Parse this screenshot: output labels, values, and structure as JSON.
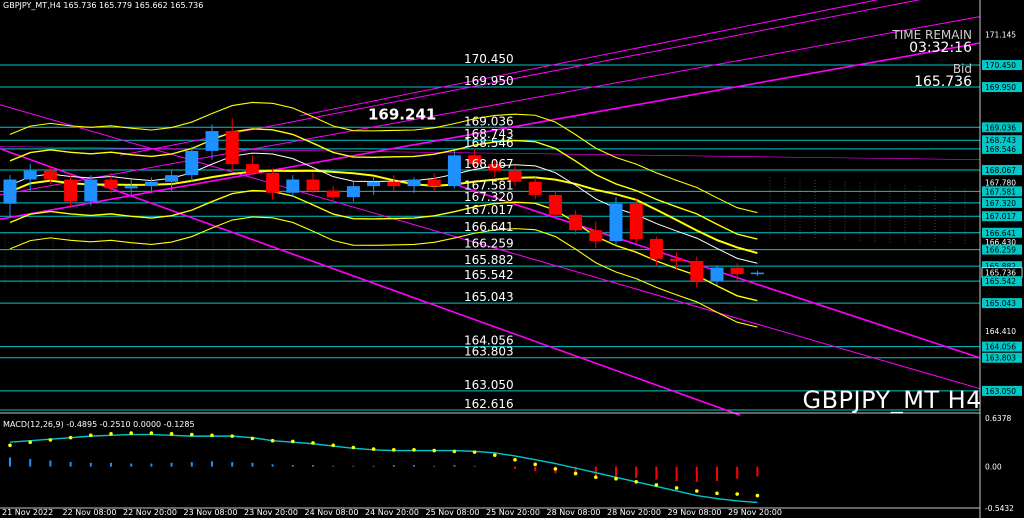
{
  "header": {
    "info": "GBPJPY_MT,H4  165.736 165.779 165.662 165.736"
  },
  "overlay": {
    "time_remain_label": "TIME REMAIN",
    "time_remain_value": "03:32:16",
    "bid_label": "Bid",
    "bid_value": "165.736",
    "symbol_label": "GBPJPY_MT  H4"
  },
  "macd": {
    "label": "MACD(12,26,9) -0.4895 -0.2510 0.0000 -0.1285"
  },
  "colors": {
    "background": "#000000",
    "bull": "#1e90ff",
    "bear": "#ff0000",
    "level": "#00c8c8",
    "channel": "#ff00ff",
    "bollinger": "#ffff00",
    "ma": "#ffffff",
    "macd_signal": "#00c8c8",
    "macd_dots": "#ffff00"
  },
  "chart_data": {
    "type": "candlestick",
    "price_ylim": [
      162.616,
      171.7
    ],
    "x_labels": [
      "21 Nov 2022",
      "22 Nov 08:00",
      "22 Nov 20:00",
      "23 Nov 08:00",
      "23 Nov 20:00",
      "24 Nov 08:00",
      "24 Nov 20:00",
      "25 Nov 08:00",
      "25 Nov 20:00",
      "28 Nov 08:00",
      "28 Nov 20:00",
      "29 Nov 08:00",
      "29 Nov 20:00"
    ],
    "right_axis_ticks": [
      "171.145",
      "170.450",
      "169.950",
      "169.036",
      "168.743",
      "168.546",
      "168.067",
      "167.780",
      "167.581",
      "167.320",
      "167.017",
      "166.641",
      "166.430",
      "166.259",
      "165.882",
      "165.736",
      "165.542",
      "165.043",
      "164.410",
      "164.056",
      "163.803",
      "163.050"
    ],
    "level_labels": [
      "170.450",
      "169.950",
      "169.036",
      "168.743",
      "168.546",
      "168.067",
      "167.581",
      "167.320",
      "167.017",
      "166.641",
      "166.259",
      "165.882",
      "165.542",
      "165.043",
      "164.056",
      "163.803",
      "163.050",
      "162.616"
    ],
    "high_label": "169.241",
    "candles": [
      {
        "o": 167.3,
        "h": 167.95,
        "l": 167.0,
        "c": 167.85
      },
      {
        "o": 167.85,
        "h": 168.2,
        "l": 167.6,
        "c": 168.05
      },
      {
        "o": 168.05,
        "h": 168.15,
        "l": 167.75,
        "c": 167.85
      },
      {
        "o": 167.85,
        "h": 168.0,
        "l": 167.2,
        "c": 167.35
      },
      {
        "o": 167.35,
        "h": 167.95,
        "l": 167.25,
        "c": 167.85
      },
      {
        "o": 167.85,
        "h": 168.0,
        "l": 167.55,
        "c": 167.65
      },
      {
        "o": 167.65,
        "h": 167.85,
        "l": 167.5,
        "c": 167.7
      },
      {
        "o": 167.7,
        "h": 167.9,
        "l": 167.55,
        "c": 167.8
      },
      {
        "o": 167.8,
        "h": 168.05,
        "l": 167.6,
        "c": 167.95
      },
      {
        "o": 167.95,
        "h": 168.6,
        "l": 167.8,
        "c": 168.5
      },
      {
        "o": 168.5,
        "h": 169.1,
        "l": 168.3,
        "c": 168.95
      },
      {
        "o": 168.95,
        "h": 169.24,
        "l": 168.05,
        "c": 168.2
      },
      {
        "o": 168.2,
        "h": 168.4,
        "l": 167.95,
        "c": 168.0
      },
      {
        "o": 168.0,
        "h": 168.1,
        "l": 167.4,
        "c": 167.55
      },
      {
        "o": 167.55,
        "h": 167.95,
        "l": 167.45,
        "c": 167.85
      },
      {
        "o": 167.85,
        "h": 168.0,
        "l": 167.55,
        "c": 167.6
      },
      {
        "o": 167.6,
        "h": 167.7,
        "l": 167.35,
        "c": 167.45
      },
      {
        "o": 167.45,
        "h": 167.8,
        "l": 167.35,
        "c": 167.7
      },
      {
        "o": 167.7,
        "h": 167.9,
        "l": 167.5,
        "c": 167.8
      },
      {
        "o": 167.8,
        "h": 167.95,
        "l": 167.6,
        "c": 167.7
      },
      {
        "o": 167.7,
        "h": 167.9,
        "l": 167.55,
        "c": 167.85
      },
      {
        "o": 167.85,
        "h": 168.0,
        "l": 167.6,
        "c": 167.7
      },
      {
        "o": 167.7,
        "h": 168.5,
        "l": 167.65,
        "c": 168.4
      },
      {
        "o": 168.4,
        "h": 168.55,
        "l": 168.1,
        "c": 168.2
      },
      {
        "o": 168.2,
        "h": 168.3,
        "l": 167.9,
        "c": 168.05
      },
      {
        "o": 168.05,
        "h": 168.15,
        "l": 167.7,
        "c": 167.8
      },
      {
        "o": 167.8,
        "h": 167.9,
        "l": 167.4,
        "c": 167.5
      },
      {
        "o": 167.5,
        "h": 167.6,
        "l": 166.95,
        "c": 167.05
      },
      {
        "o": 167.05,
        "h": 167.15,
        "l": 166.6,
        "c": 166.7
      },
      {
        "o": 166.7,
        "h": 166.9,
        "l": 166.3,
        "c": 166.45
      },
      {
        "o": 166.45,
        "h": 167.45,
        "l": 166.35,
        "c": 167.3
      },
      {
        "o": 167.3,
        "h": 167.4,
        "l": 166.4,
        "c": 166.5
      },
      {
        "o": 166.5,
        "h": 166.55,
        "l": 165.9,
        "c": 166.05
      },
      {
        "o": 166.05,
        "h": 166.2,
        "l": 165.8,
        "c": 166.0
      },
      {
        "o": 166.0,
        "h": 166.1,
        "l": 165.4,
        "c": 165.55
      },
      {
        "o": 165.55,
        "h": 165.9,
        "l": 165.45,
        "c": 165.85
      },
      {
        "o": 165.85,
        "h": 165.95,
        "l": 165.55,
        "c": 165.7
      },
      {
        "o": 165.7,
        "h": 165.78,
        "l": 165.66,
        "c": 165.736
      }
    ],
    "macd_ylim": [
      -0.5432,
      0.6378
    ],
    "macd_ticks": [
      "0.6378",
      "0.00",
      "-0.5432"
    ],
    "macd_hist": [
      0.12,
      0.1,
      0.08,
      0.06,
      0.05,
      0.05,
      0.04,
      0.04,
      0.05,
      0.06,
      0.07,
      0.06,
      0.05,
      0.03,
      0.02,
      0.02,
      0.01,
      0.01,
      0.01,
      0.02,
      0.02,
      0.01,
      0.02,
      0.01,
      0.0,
      -0.03,
      -0.06,
      -0.09,
      -0.12,
      -0.14,
      -0.13,
      -0.15,
      -0.17,
      -0.19,
      -0.2,
      -0.19,
      -0.16,
      -0.13
    ],
    "macd_signal": [
      0.32,
      0.34,
      0.36,
      0.38,
      0.4,
      0.41,
      0.42,
      0.42,
      0.41,
      0.4,
      0.4,
      0.4,
      0.38,
      0.34,
      0.32,
      0.3,
      0.27,
      0.24,
      0.22,
      0.21,
      0.21,
      0.21,
      0.21,
      0.2,
      0.18,
      0.14,
      0.09,
      0.04,
      -0.02,
      -0.08,
      -0.14,
      -0.2,
      -0.26,
      -0.32,
      -0.38,
      -0.42,
      -0.45,
      -0.47
    ],
    "macd_dots": [
      0.28,
      0.32,
      0.35,
      0.38,
      0.41,
      0.43,
      0.44,
      0.44,
      0.43,
      0.42,
      0.41,
      0.4,
      0.37,
      0.34,
      0.33,
      0.31,
      0.28,
      0.25,
      0.23,
      0.22,
      0.22,
      0.21,
      0.2,
      0.19,
      0.15,
      0.09,
      0.03,
      -0.03,
      -0.09,
      -0.14,
      -0.16,
      -0.2,
      -0.24,
      -0.28,
      -0.32,
      -0.35,
      -0.36,
      -0.38
    ]
  }
}
